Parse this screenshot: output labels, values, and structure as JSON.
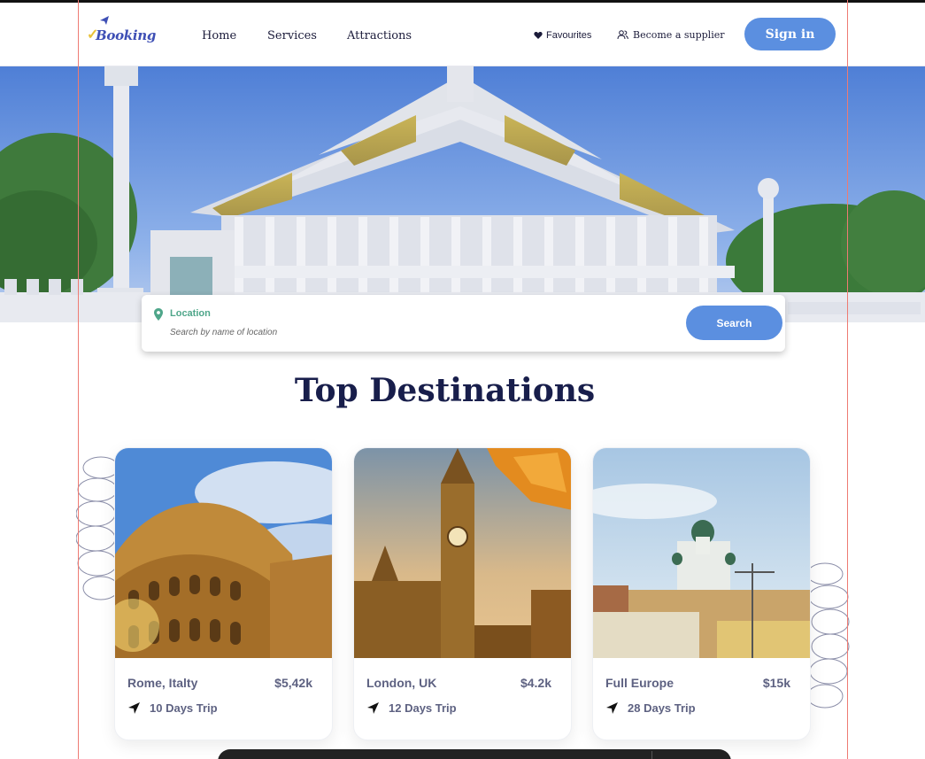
{
  "header": {
    "logo_text": "Booking",
    "nav": [
      {
        "label": "Home"
      },
      {
        "label": "Services"
      },
      {
        "label": "Attractions"
      }
    ],
    "favourites_label": "Favourites",
    "supplier_label": "Become a supplier",
    "signin_label": "Sign in"
  },
  "search": {
    "label": "Location",
    "placeholder": "Search by name of location",
    "button_label": "Search"
  },
  "section_title": "Top Destinations",
  "destinations": [
    {
      "name": "Rome, Italty",
      "price": "$5,42k",
      "trip": "10 Days Trip"
    },
    {
      "name": "London, UK",
      "price": "$4.2k",
      "trip": "12 Days Trip"
    },
    {
      "name": "Full Europe",
      "price": "$15k",
      "trip": "28 Days Trip"
    }
  ],
  "colors": {
    "accent": "#5b8fe0",
    "heading": "#181e4b",
    "card_text": "#5e6282",
    "location_green": "#4fa68a"
  }
}
